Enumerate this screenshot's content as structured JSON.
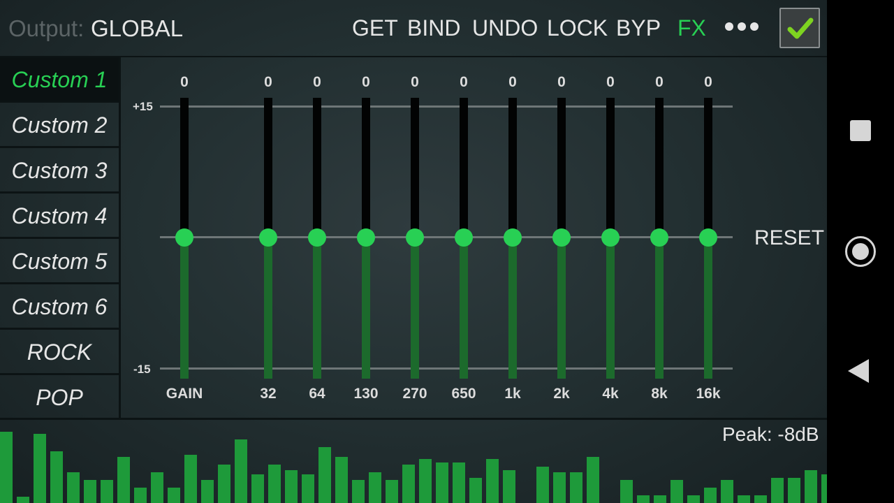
{
  "topbar": {
    "output_label": "Output:",
    "output_value": "GLOBAL",
    "buttons": [
      {
        "label": "GET",
        "color": "#e6e6e6"
      },
      {
        "label": "BIND",
        "color": "#e6e6e6"
      },
      {
        "label": "UNDO",
        "color": "#e6e6e6"
      },
      {
        "label": "LOCK",
        "color": "#e6e6e6"
      },
      {
        "label": "BYP",
        "color": "#e6e6e6"
      },
      {
        "label": "FX",
        "color": "#28d054"
      }
    ],
    "more_icon": "more-dots-icon",
    "enabled_checked": true
  },
  "presets": [
    {
      "label": "Custom 1",
      "active": true
    },
    {
      "label": "Custom 2",
      "active": false
    },
    {
      "label": "Custom 3",
      "active": false
    },
    {
      "label": "Custom 4",
      "active": false
    },
    {
      "label": "Custom 5",
      "active": false
    },
    {
      "label": "Custom 6",
      "active": false
    },
    {
      "label": "ROCK",
      "active": false
    },
    {
      "label": "POP",
      "active": false
    }
  ],
  "eq": {
    "scale_max": "+15",
    "scale_min": "-15",
    "range": [
      -15,
      15
    ],
    "bands": [
      {
        "name": "GAIN",
        "value": 0
      },
      {
        "name": "32",
        "value": 0
      },
      {
        "name": "64",
        "value": 0
      },
      {
        "name": "130",
        "value": 0
      },
      {
        "name": "270",
        "value": 0
      },
      {
        "name": "650",
        "value": 0
      },
      {
        "name": "1k",
        "value": 0
      },
      {
        "name": "2k",
        "value": 0
      },
      {
        "name": "4k",
        "value": 0
      },
      {
        "name": "8k",
        "value": 0
      },
      {
        "name": "16k",
        "value": 0
      }
    ],
    "reset_label": "RESET",
    "accent": "#28d054"
  },
  "spectrum": {
    "peak_text": "Peak: -8dB",
    "levels": [
      0.93,
      0.08,
      0.9,
      0.67,
      0.4,
      0.3,
      0.3,
      0.6,
      0.2,
      0.4,
      0.2,
      0.63,
      0.3,
      0.5,
      0.83,
      0.37,
      0.5,
      0.43,
      0.37,
      0.73,
      0.6,
      0.3,
      0.4,
      0.3,
      0.5,
      0.57,
      0.53,
      0.53,
      0.33,
      0.57,
      0.43,
      0,
      0.47,
      0.4,
      0.4,
      0.6,
      0,
      0.3,
      0.1,
      0.1,
      0.3,
      0.1,
      0.2,
      0.3,
      0.1,
      0.1,
      0.33,
      0.33,
      0.43,
      0.37
    ],
    "color": "#1e9a3a"
  },
  "navbar": {
    "recents_icon": "recents-square-icon",
    "home_icon": "home-circle-icon",
    "back_icon": "back-triangle-icon"
  }
}
